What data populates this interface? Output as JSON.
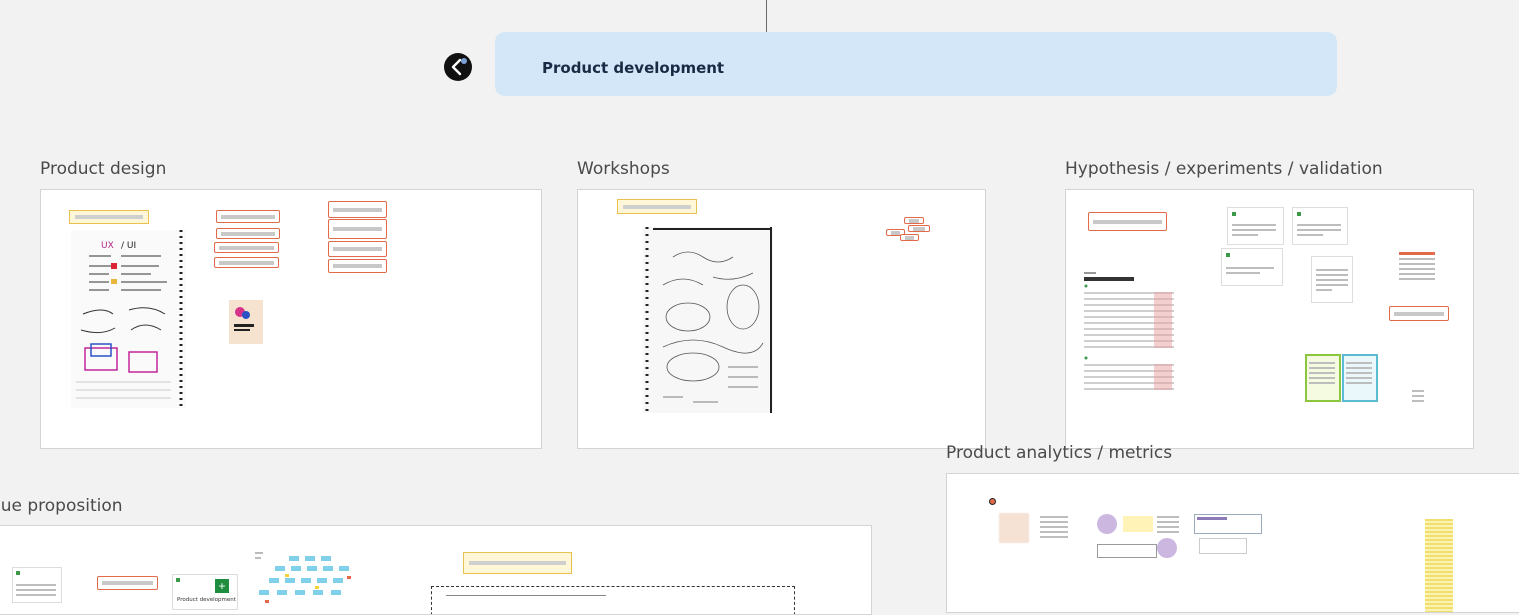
{
  "header": {
    "title": "Product development"
  },
  "frames": {
    "product_design": {
      "title": "Product design"
    },
    "workshops": {
      "title": "Workshops"
    },
    "hypothesis": {
      "title": "Hypothesis / experiments / validation"
    },
    "analytics": {
      "title": "Product analytics / metrics"
    },
    "value_proposition": {
      "title": "lue proposition"
    }
  },
  "value_prop_card": {
    "label": "Product development"
  },
  "colors": {
    "background": "#f2f2f2",
    "header_card": "#d3e7f9",
    "sticky_border": "#e06a4a",
    "sticky_yellow": "#e8c24c"
  },
  "icons": {
    "back": "arrow-left-icon"
  }
}
